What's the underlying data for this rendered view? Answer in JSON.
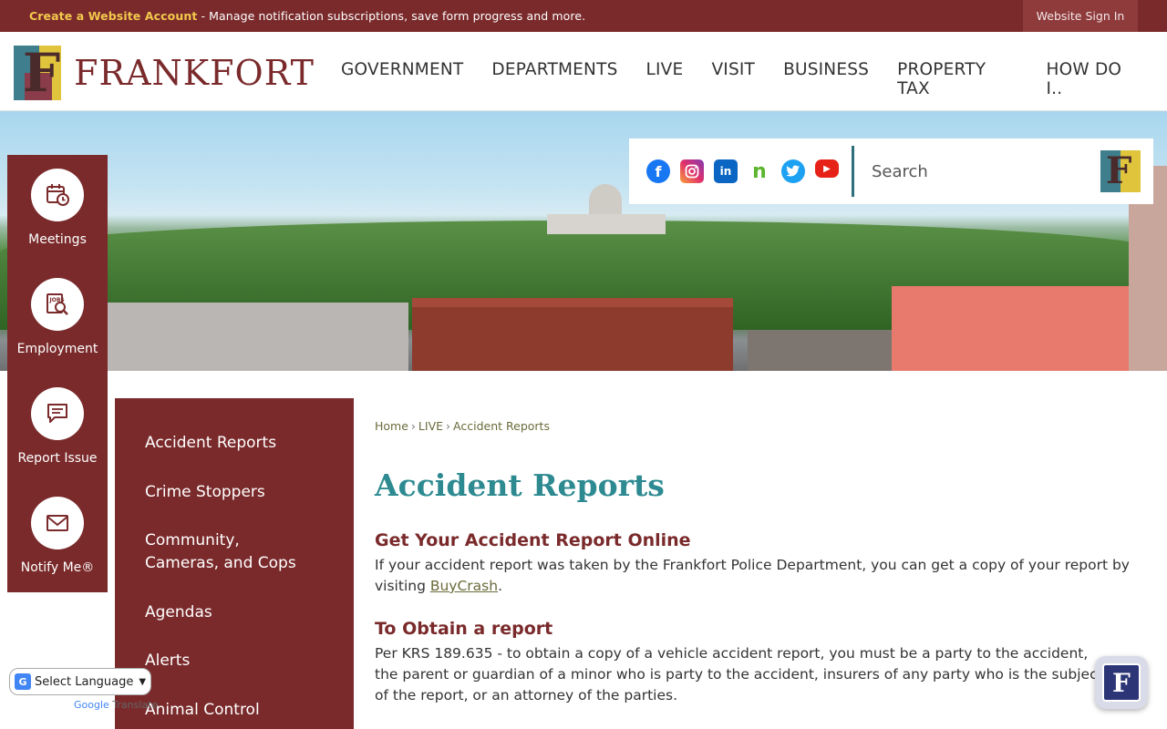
{
  "topbar": {
    "create_account": "Create a Website Account",
    "message": " - Manage notification subscriptions, save form progress and more.",
    "sign_in": "Website Sign In"
  },
  "header": {
    "logo_text": "FRANKFORT",
    "nav": [
      "GOVERNMENT",
      "DEPARTMENTS",
      "LIVE",
      "VISIT",
      "BUSINESS",
      "PROPERTY TAX",
      "HOW DO I.."
    ]
  },
  "social": {
    "icons": [
      "facebook-icon",
      "instagram-icon",
      "linkedin-icon",
      "nextdoor-icon",
      "twitter-icon",
      "youtube-icon"
    ]
  },
  "search": {
    "placeholder": "Search"
  },
  "quick_links": [
    {
      "label": "Meetings",
      "icon": "calendar-clock-icon"
    },
    {
      "label": "Employment",
      "icon": "jobs-search-icon"
    },
    {
      "label": "Report Issue",
      "icon": "chat-bubble-icon"
    },
    {
      "label": "Notify Me®",
      "icon": "envelope-icon"
    }
  ],
  "sidenav": {
    "items": [
      "Accident Reports",
      "Crime Stoppers",
      "Community, Cameras, and Cops",
      "Agendas",
      "Alerts",
      "Animal Control"
    ]
  },
  "breadcrumb": [
    "Home",
    "LIVE",
    "Accident Reports"
  ],
  "main": {
    "title": "Accident Reports",
    "section1_heading": "Get Your Accident Report Online",
    "section1_text": "If your accident report was taken by the Frankfort Police Department, you can get a copy of your report by visiting ",
    "section1_link": "BuyCrash",
    "section1_end": ".",
    "section2_heading": "To Obtain a report",
    "section2_text": "Per KRS 189.635 - to obtain a copy of a vehicle accident report, you must be a party to the accident, the parent or guardian of a minor who is party to the accident, insurers of any party who is the subject of the report, or an attorney of the parties."
  },
  "translate": {
    "select_label": "Select Language",
    "powered_by": "Google",
    "translate_word": "Translate"
  },
  "colors": {
    "brand": "#7a2a2b",
    "title_teal": "#2d8a91",
    "accent_yellow": "#f2c94c"
  }
}
